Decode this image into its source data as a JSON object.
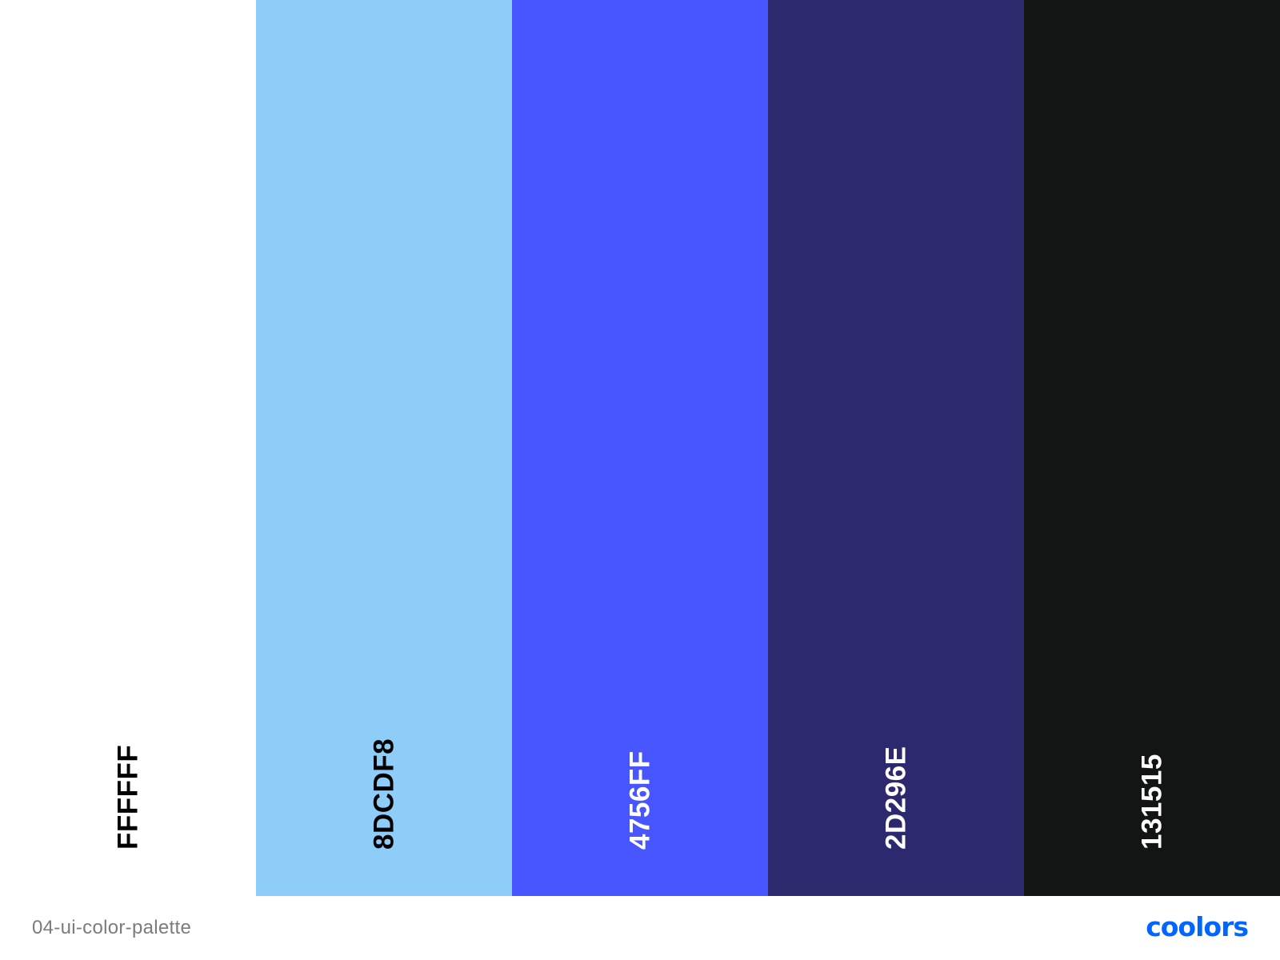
{
  "swatches": [
    {
      "hex_label": "FFFFFF",
      "color": "#FFFFFF",
      "text_color": "#000000"
    },
    {
      "hex_label": "8DCDF8",
      "color": "#8DCDF8",
      "text_color": "#000000"
    },
    {
      "hex_label": "4756FF",
      "color": "#4756FF",
      "text_color": "#FFFFFF"
    },
    {
      "hex_label": "2D296E",
      "color": "#2D296E",
      "text_color": "#FFFFFF"
    },
    {
      "hex_label": "131515",
      "color": "#131515",
      "text_color": "#FFFFFF"
    }
  ],
  "footer": {
    "palette_name": "04-ui-color-palette",
    "brand_logo": "coolors",
    "brand_color": "#0066FF"
  }
}
